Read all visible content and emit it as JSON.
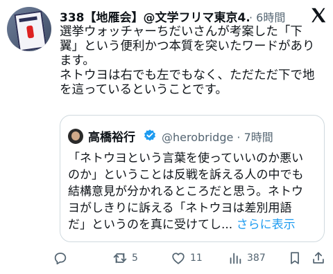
{
  "post": {
    "author": "338【地雁会】@文学フリマ東京4...",
    "timestamp": "· 6時間",
    "lines": [
      "選挙ウォッチャーちだいさんが考案した「下",
      "翼」という便利かつ本質を突いたワードがあり",
      "ます。",
      "ネトウヨは右でも左でもなく、ただただ下で地",
      "を這っているということです。"
    ]
  },
  "quote": {
    "name": "高橋裕行",
    "handle": "@herobridge · 7時間",
    "lines": [
      "「ネトウヨという言葉を使っていいのか悪い",
      "のか」ということは反戦を訴える人の中でも",
      "結構意見が分かれるところだと思う。ネトウ",
      "ヨがしきりに訴える「ネトウヨは差別用語"
    ],
    "last_line": "だ」というのを真に受けてし...",
    "show_more": "さらに表示"
  },
  "actions": {
    "reply_count": "",
    "repost_count": "5",
    "like_count": "11",
    "views_count": "387"
  },
  "icons": [
    "x-logo-icon",
    "verified-badge-icon",
    "reply-icon",
    "repost-icon",
    "like-icon",
    "views-icon",
    "bookmark-icon",
    "share-icon"
  ],
  "colors": {
    "link": "#1d9bf0",
    "verified": "#1d9bf0",
    "muted": "#536471",
    "border": "#cfd9de"
  }
}
